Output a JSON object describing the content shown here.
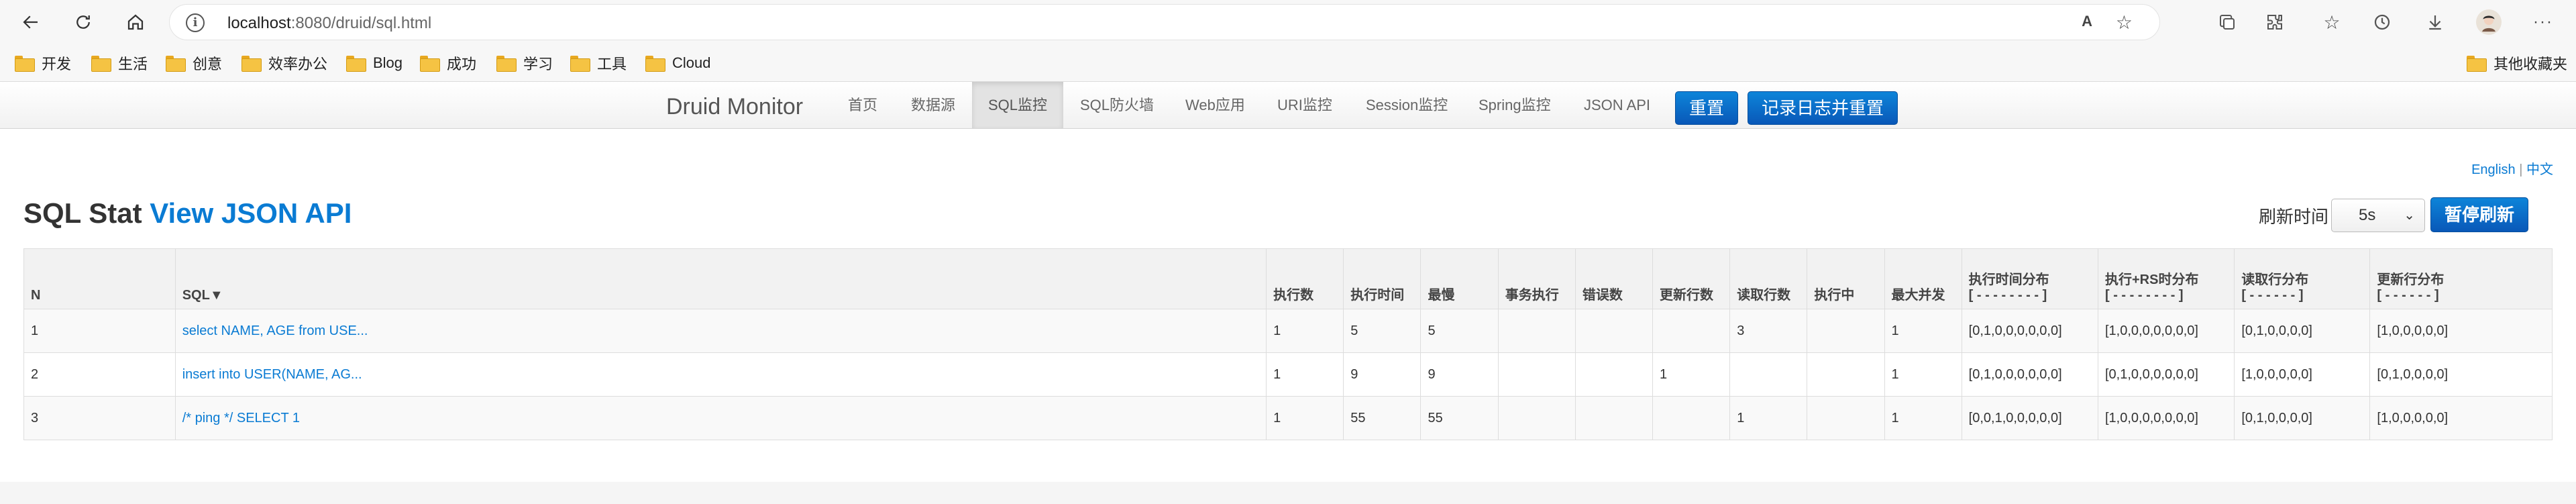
{
  "browser": {
    "url_host": "localhost",
    "url_rest": ":8080/druid/sql.html",
    "icons": [
      "back-icon",
      "refresh-icon",
      "home-icon",
      "info-icon",
      "read-aloud-icon",
      "add-favorite-icon",
      "collections-icon",
      "extensions-icon",
      "favorites-icon",
      "history-icon",
      "downloads-icon",
      "profile-icon",
      "more-icon"
    ],
    "read_aloud_label": "A",
    "more_label": "···",
    "bookmarks": [
      "开发",
      "生活",
      "创意",
      "效率办公",
      "Blog",
      "成功",
      "学习",
      "工具",
      "Cloud"
    ],
    "other_bookmarks": "其他收藏夹"
  },
  "navbar": {
    "brand": "Druid Monitor",
    "items": [
      "首页",
      "数据源",
      "SQL监控",
      "SQL防火墙",
      "Web应用",
      "URI监控",
      "Session监控",
      "Spring监控",
      "JSON API"
    ],
    "active_index": 2,
    "reset_button": "重置",
    "log_reset_button": "记录日志并重置"
  },
  "lang": {
    "english": "English",
    "separator": "|",
    "chinese": "中文"
  },
  "page": {
    "title": "SQL Stat",
    "json_link": "View JSON API",
    "refresh_label": "刷新时间",
    "refresh_value": "5s",
    "pause_button": "暂停刷新"
  },
  "table": {
    "headers": [
      "N",
      "SQL▼",
      "执行数",
      "执行时间",
      "最慢",
      "事务执行",
      "错误数",
      "更新行数",
      "读取行数",
      "执行中",
      "最大并发",
      "执行时间分布",
      "执行+RS时分布",
      "读取行分布",
      "更新行分布"
    ],
    "header_subs": [
      "[ - - - - - - - - ]",
      "[ - - - - - - - - ]",
      "[ - - - - - - ]",
      "[ - - - - - - ]"
    ],
    "rows": [
      [
        "1",
        "select NAME, AGE from USE...",
        "1",
        "5",
        "5",
        "",
        "",
        "",
        "3",
        "",
        "1",
        "[0,1,0,0,0,0,0,0]",
        "[1,0,0,0,0,0,0,0]",
        "[0,1,0,0,0,0]",
        "[1,0,0,0,0,0]"
      ],
      [
        "2",
        "insert into USER(NAME, AG...",
        "1",
        "9",
        "9",
        "",
        "",
        "1",
        "",
        "",
        "1",
        "[0,1,0,0,0,0,0,0]",
        "[0,1,0,0,0,0,0,0]",
        "[1,0,0,0,0,0]",
        "[0,1,0,0,0,0]"
      ],
      [
        "3",
        "/* ping */ SELECT 1",
        "1",
        "55",
        "55",
        "",
        "",
        "",
        "1",
        "",
        "1",
        "[0,0,1,0,0,0,0,0]",
        "[1,0,0,0,0,0,0,0]",
        "[0,1,0,0,0,0]",
        "[1,0,0,0,0,0]"
      ]
    ]
  },
  "colors": {
    "link": "#0a7bd3",
    "button": "#0a6cc8",
    "folder": "#f5c343"
  }
}
